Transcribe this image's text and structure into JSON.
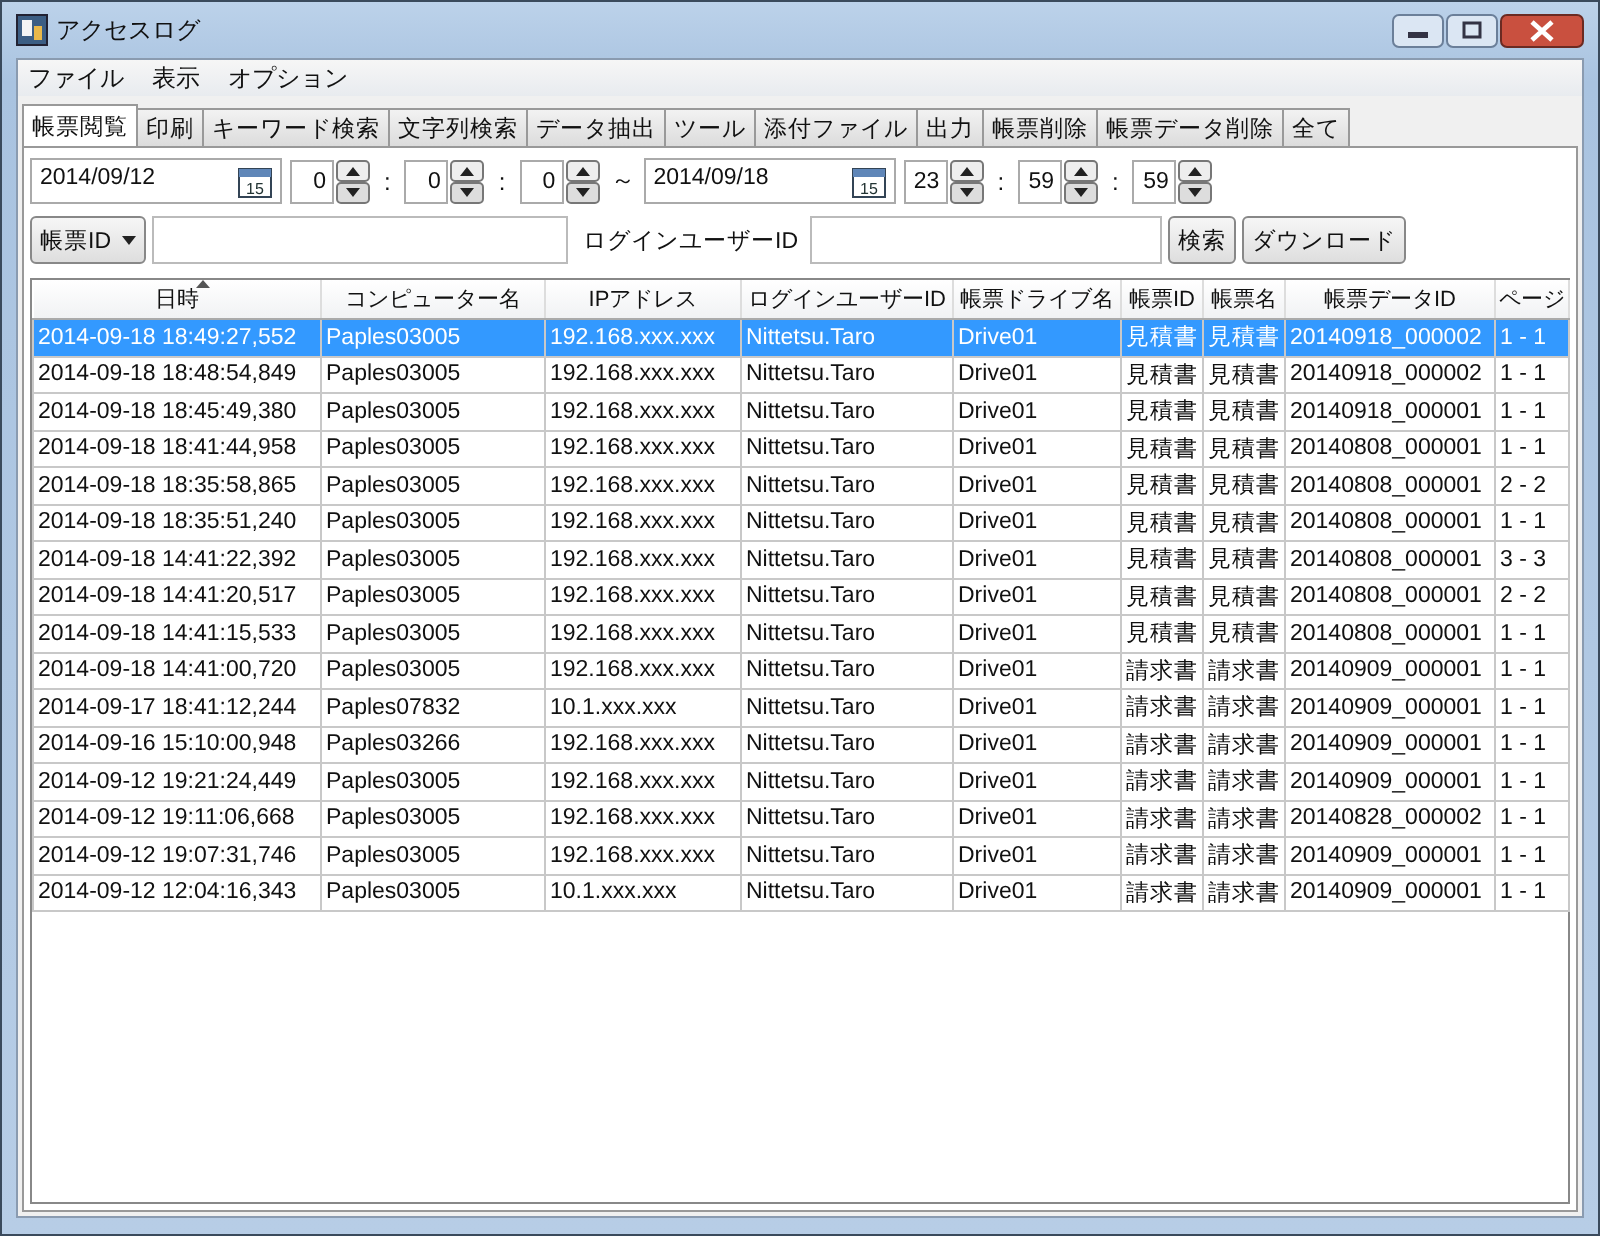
{
  "window": {
    "title": "アクセスログ"
  },
  "menu": [
    "ファイル",
    "表示",
    "オプション"
  ],
  "tabs": [
    {
      "label": "帳票閲覧",
      "selected": true
    },
    {
      "label": "印刷",
      "selected": false
    },
    {
      "label": "キーワード検索",
      "selected": false
    },
    {
      "label": "文字列検索",
      "selected": false
    },
    {
      "label": "データ抽出",
      "selected": false
    },
    {
      "label": "ツール",
      "selected": false
    },
    {
      "label": "添付ファイル",
      "selected": false
    },
    {
      "label": "出力",
      "selected": false
    },
    {
      "label": "帳票削除",
      "selected": false
    },
    {
      "label": "帳票データ削除",
      "selected": false
    },
    {
      "label": "全て",
      "selected": false
    }
  ],
  "range": {
    "from_date": "2014/09/12",
    "from_time": [
      "0",
      "0",
      "0"
    ],
    "separator": "～",
    "to_date": "2014/09/18",
    "to_time": [
      "23",
      "59",
      "59"
    ],
    "time_separator": ":",
    "calendar_labels": [
      "15",
      "15"
    ]
  },
  "filter": {
    "dropdown": "帳票ID",
    "user_label": "ログインユーザーID",
    "search_button": "検索",
    "download_button": "ダウンロード"
  },
  "table": {
    "columns": [
      "日時",
      "コンピューター名",
      "IPアドレス",
      "ログインユーザーID",
      "帳票ドライブ名",
      "帳票ID",
      "帳票名",
      "帳票データID",
      "ページ"
    ],
    "rows": [
      {
        "selected": true,
        "cells": [
          "2014-09-18 18:49:27,552",
          "Paples03005",
          "192.168.xxx.xxx",
          "Nittetsu.Taro",
          "Drive01",
          "見積書",
          "見積書",
          "20140918_000002",
          "1 - 1"
        ]
      },
      {
        "selected": false,
        "cells": [
          "2014-09-18 18:48:54,849",
          "Paples03005",
          "192.168.xxx.xxx",
          "Nittetsu.Taro",
          "Drive01",
          "見積書",
          "見積書",
          "20140918_000002",
          "1 - 1"
        ]
      },
      {
        "selected": false,
        "cells": [
          "2014-09-18 18:45:49,380",
          "Paples03005",
          "192.168.xxx.xxx",
          "Nittetsu.Taro",
          "Drive01",
          "見積書",
          "見積書",
          "20140918_000001",
          "1 - 1"
        ]
      },
      {
        "selected": false,
        "cells": [
          "2014-09-18 18:41:44,958",
          "Paples03005",
          "192.168.xxx.xxx",
          "Nittetsu.Taro",
          "Drive01",
          "見積書",
          "見積書",
          "20140808_000001",
          "1 - 1"
        ]
      },
      {
        "selected": false,
        "cells": [
          "2014-09-18 18:35:58,865",
          "Paples03005",
          "192.168.xxx.xxx",
          "Nittetsu.Taro",
          "Drive01",
          "見積書",
          "見積書",
          "20140808_000001",
          "2 - 2"
        ]
      },
      {
        "selected": false,
        "cells": [
          "2014-09-18 18:35:51,240",
          "Paples03005",
          "192.168.xxx.xxx",
          "Nittetsu.Taro",
          "Drive01",
          "見積書",
          "見積書",
          "20140808_000001",
          "1 - 1"
        ]
      },
      {
        "selected": false,
        "cells": [
          "2014-09-18 14:41:22,392",
          "Paples03005",
          "192.168.xxx.xxx",
          "Nittetsu.Taro",
          "Drive01",
          "見積書",
          "見積書",
          "20140808_000001",
          "3 - 3"
        ]
      },
      {
        "selected": false,
        "cells": [
          "2014-09-18 14:41:20,517",
          "Paples03005",
          "192.168.xxx.xxx",
          "Nittetsu.Taro",
          "Drive01",
          "見積書",
          "見積書",
          "20140808_000001",
          "2 - 2"
        ]
      },
      {
        "selected": false,
        "cells": [
          "2014-09-18 14:41:15,533",
          "Paples03005",
          "192.168.xxx.xxx",
          "Nittetsu.Taro",
          "Drive01",
          "見積書",
          "見積書",
          "20140808_000001",
          "1 - 1"
        ]
      },
      {
        "selected": false,
        "cells": [
          "2014-09-18 14:41:00,720",
          "Paples03005",
          "192.168.xxx.xxx",
          "Nittetsu.Taro",
          "Drive01",
          "請求書",
          "請求書",
          "20140909_000001",
          "1 - 1"
        ]
      },
      {
        "selected": false,
        "cells": [
          "2014-09-17 18:41:12,244",
          "Paples07832",
          "10.1.xxx.xxx",
          "Nittetsu.Taro",
          "Drive01",
          "請求書",
          "請求書",
          "20140909_000001",
          "1 - 1"
        ]
      },
      {
        "selected": false,
        "cells": [
          "2014-09-16 15:10:00,948",
          "Paples03266",
          "192.168.xxx.xxx",
          "Nittetsu.Taro",
          "Drive01",
          "請求書",
          "請求書",
          "20140909_000001",
          "1 - 1"
        ]
      },
      {
        "selected": false,
        "cells": [
          "2014-09-12 19:21:24,449",
          "Paples03005",
          "192.168.xxx.xxx",
          "Nittetsu.Taro",
          "Drive01",
          "請求書",
          "請求書",
          "20140909_000001",
          "1 - 1"
        ]
      },
      {
        "selected": false,
        "cells": [
          "2014-09-12 19:11:06,668",
          "Paples03005",
          "192.168.xxx.xxx",
          "Nittetsu.Taro",
          "Drive01",
          "請求書",
          "請求書",
          "20140828_000002",
          "1 - 1"
        ]
      },
      {
        "selected": false,
        "cells": [
          "2014-09-12 19:07:31,746",
          "Paples03005",
          "192.168.xxx.xxx",
          "Nittetsu.Taro",
          "Drive01",
          "請求書",
          "請求書",
          "20140909_000001",
          "1 - 1"
        ]
      },
      {
        "selected": false,
        "cells": [
          "2014-09-12 12:04:16,343",
          "Paples03005",
          "10.1.xxx.xxx",
          "Nittetsu.Taro",
          "Drive01",
          "請求書",
          "請求書",
          "20140909_000001",
          "1 - 1"
        ]
      }
    ]
  }
}
